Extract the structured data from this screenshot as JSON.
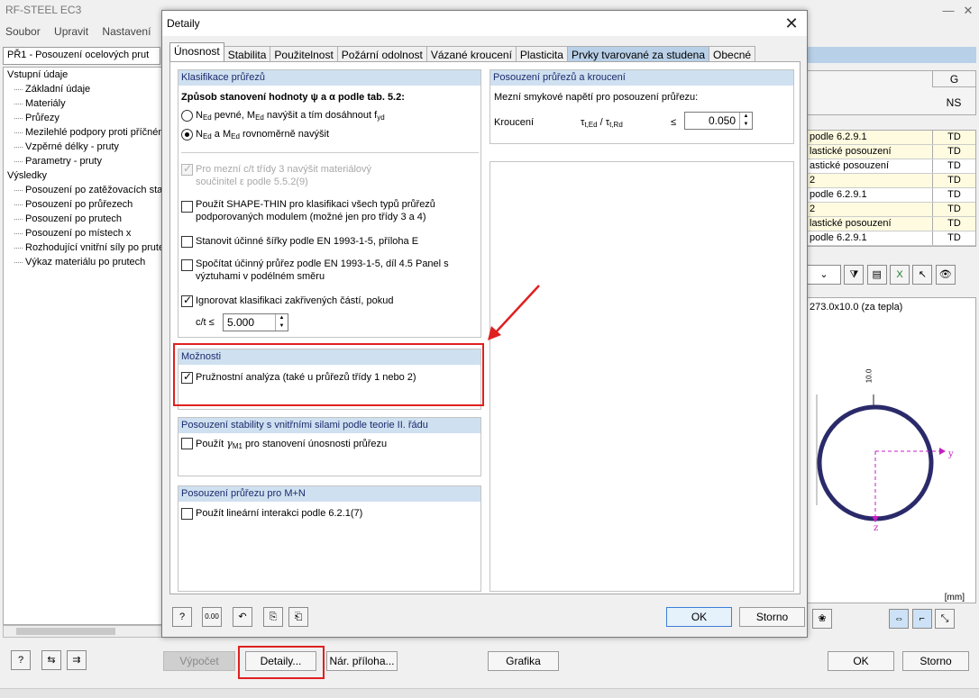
{
  "app": {
    "title": "RF-STEEL EC3",
    "menu": [
      "Soubor",
      "Upravit",
      "Nastavení"
    ],
    "case_select": "PŘ1 - Posouzení ocelových prut",
    "tree": [
      {
        "level": 0,
        "label": "Vstupní údaje"
      },
      {
        "level": 1,
        "label": "Základní údaje"
      },
      {
        "level": 1,
        "label": "Materiály"
      },
      {
        "level": 1,
        "label": "Průřezy"
      },
      {
        "level": 1,
        "label": "Mezilehlé podpory proti příčném"
      },
      {
        "level": 1,
        "label": "Vzpěrné délky - pruty"
      },
      {
        "level": 1,
        "label": "Parametry - pruty"
      },
      {
        "level": 0,
        "label": "Výsledky"
      },
      {
        "level": 1,
        "label": "Posouzení po zatěžovacích stav"
      },
      {
        "level": 1,
        "label": "Posouzení po průřezech"
      },
      {
        "level": 1,
        "label": "Posouzení po prutech"
      },
      {
        "level": 1,
        "label": "Posouzení po místech x"
      },
      {
        "level": 1,
        "label": "Rozhodující vnitřní síly po prute"
      },
      {
        "level": 1,
        "label": "Výkaz materiálu po prutech"
      }
    ],
    "right": {
      "col_g": "G",
      "col_ns": "NS",
      "rows": [
        {
          "text": "podle 6.2.9.1",
          "code": "TD",
          "hl": true
        },
        {
          "text": "lastické posouzení",
          "code": "TD",
          "hl": true
        },
        {
          "text": "astické posouzení",
          "code": "TD",
          "hl": false
        },
        {
          "text": "2",
          "code": "TD",
          "hl": true
        },
        {
          "text": "podle 6.2.9.1",
          "code": "TD",
          "hl": false
        },
        {
          "text": "2",
          "code": "TD",
          "hl": true
        },
        {
          "text": "lastické posouzení",
          "code": "TD",
          "hl": true
        },
        {
          "text": "podle 6.2.9.1",
          "code": "TD",
          "hl": false
        }
      ],
      "section_label": "273.0x10.0 (za tepla)",
      "thickness_label": "10.0",
      "axis_y": "y",
      "axis_z": "z",
      "unit": "[mm]"
    },
    "buttons": {
      "calc": "Výpočet",
      "details": "Detaily...",
      "national_annex": "Nár. příloha...",
      "graphics": "Grafika",
      "ok": "OK",
      "cancel": "Storno"
    }
  },
  "dialog": {
    "title": "Detaily",
    "tabs": [
      "Únosnost",
      "Stabilita",
      "Použitelnost",
      "Požární odolnost",
      "Vázané kroucení",
      "Plasticita",
      "Prvky tvarované za studena",
      "Obecné"
    ],
    "active_tab": 0,
    "classification": {
      "heading": "Klasifikace průřezů",
      "method_label": "Způsob stanovení hodnoty ψ a α podle tab. 5.2:",
      "radio1_a": "N",
      "radio1_b": "Ed",
      "radio1_c": " pevné, M",
      "radio1_d": "Ed",
      "radio1_e": " navýšit a tím dosáhnout f",
      "radio1_f": "yd",
      "radio2_a": "N",
      "radio2_b": "Ed",
      "radio2_c": " a M",
      "radio2_d": "Ed",
      "radio2_e": " rovnoměrně navýšit",
      "cb_class3_line1": "Pro mezní c/t třídy 3 navýšit materiálový",
      "cb_class3_line2": "součinitel ε podle 5.5.2(9)",
      "cb_shapethin_line1": "Použít SHAPE-THIN pro klasifikaci všech typů průřezů",
      "cb_shapethin_line2": "podporovaných modulem (možné jen pro třídy 3 a 4)",
      "cb_effwidth": "Stanovit účinné šířky podle EN 1993-1-5, příloha E",
      "cb_effsect_line1": "Spočítat účinný průřez podle EN 1993-1-5, díl 4.5 Panel s",
      "cb_effsect_line2": "výztuhami v podélném směru",
      "cb_ignore": "Ignorovat klasifikaci zakřivených částí, pokud",
      "ct_label": "c/t ≤",
      "ct_value": "5.000"
    },
    "options": {
      "heading": "Možnosti",
      "cb_elastic": "Pružnostní analýza (také u průřezů třídy 1 nebo 2)"
    },
    "stability": {
      "heading": "Posouzení stability s vnitřními silami podle teorie II. řádu",
      "cb_a": "Použít ",
      "cb_gamma": "γ",
      "cb_sub": "M1",
      "cb_b": " pro stanovení únosnosti průřezu"
    },
    "mn": {
      "heading": "Posouzení průřezu pro M+N",
      "cb_linear": "Použít lineární interakci podle 6.2.1(7)"
    },
    "torsion": {
      "heading": "Posouzení průřezů a kroucení",
      "label": "Mezní smykové napětí pro posouzení průřezu:",
      "row_label": "Kroucení",
      "ratio_a": "τ",
      "ratio_a_sub": "t,Ed",
      "ratio_sep": " / τ",
      "ratio_b_sub": "t,Rd",
      "le": "≤",
      "value": "0.050"
    },
    "footer": {
      "ok": "OK",
      "cancel": "Storno"
    }
  }
}
